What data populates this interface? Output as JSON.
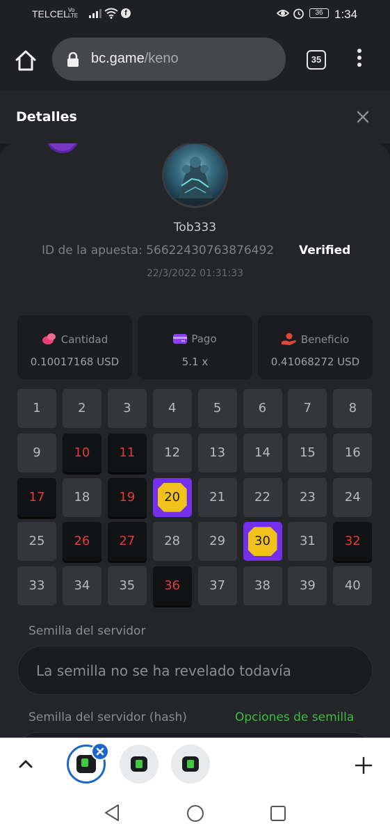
{
  "status_bar": {
    "carrier": "TELCEL",
    "volte": "Vo LTE",
    "battery": "36",
    "time": "1:34",
    "icons": [
      "signal-icon",
      "wifi-icon",
      "facebook-icon",
      "eye-icon",
      "alarm-icon",
      "battery-icon"
    ]
  },
  "browser": {
    "url_host": "bc.game",
    "url_path": "/keno",
    "tab_count": "35"
  },
  "details": {
    "title": "Detalles",
    "username": "Tob333",
    "bet_id": "ID de la apuesta: 56622430763876492",
    "verified": "Verified",
    "datetime": "22/3/2022 01:31:33"
  },
  "stats": [
    {
      "label": "Cantidad",
      "value": "0.10017168 USD",
      "icon": "coins-icon",
      "color": "#e8417a"
    },
    {
      "label": "Pago",
      "value": "5.1 x",
      "icon": "card-icon",
      "color": "#8a3ff0"
    },
    {
      "label": "Beneficio",
      "value": "0.41068272 USD",
      "icon": "profit-hand-icon",
      "color": "#e0493a"
    }
  ],
  "grid": {
    "numbers": [
      "1",
      "2",
      "3",
      "4",
      "5",
      "6",
      "7",
      "8",
      "9",
      "10",
      "11",
      "12",
      "13",
      "14",
      "15",
      "16",
      "17",
      "18",
      "19",
      "20",
      "21",
      "22",
      "23",
      "24",
      "25",
      "26",
      "27",
      "28",
      "29",
      "30",
      "31",
      "32",
      "33",
      "34",
      "35",
      "36",
      "37",
      "38",
      "39",
      "40"
    ],
    "picked_missed": [
      "10",
      "11",
      "17",
      "19",
      "26",
      "27",
      "32",
      "36"
    ],
    "hits": [
      "20",
      "30"
    ]
  },
  "seed": {
    "server_seed_label": "Semilla del servidor",
    "server_seed_placeholder": "La semilla no se ha revelado todavía",
    "hash_label": "Semilla del servidor (hash)",
    "options_link": "Opciones de semilla"
  },
  "colors": {
    "accent_purple": "#7330e8",
    "gem_gold": "#f2c21c",
    "miss_red": "#e23a3a",
    "link_green": "#3bbf3b",
    "tab_active_blue": "#1b66c9"
  }
}
